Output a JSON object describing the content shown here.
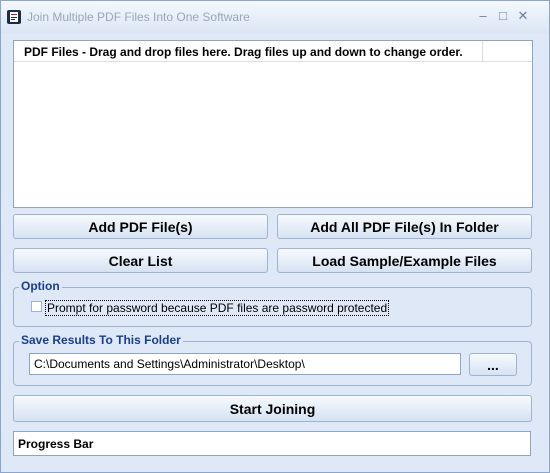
{
  "window": {
    "title": "Join Multiple PDF Files Into One Software",
    "minimize_icon": "minimize-icon",
    "maximize_icon": "maximize-icon",
    "close_icon": "close-icon"
  },
  "file_list": {
    "header": "PDF Files - Drag and drop files here. Drag files up and down to change order.",
    "items": []
  },
  "buttons": {
    "add_pdf": "Add PDF File(s)",
    "add_folder": "Add All PDF File(s) In Folder",
    "clear_list": "Clear List",
    "load_sample": "Load Sample/Example Files",
    "browse": "...",
    "start_joining": "Start Joining"
  },
  "option": {
    "group_label": "Option",
    "password_checkbox_label": "Prompt for password because PDF files are password protected",
    "password_checked": false
  },
  "save": {
    "group_label": "Save Results To This Folder",
    "path": "C:\\Documents and Settings\\Administrator\\Desktop\\"
  },
  "progress": {
    "label": "Progress Bar"
  },
  "colors": {
    "background": "#dfe8f6",
    "group_label": "#1a3f8f",
    "border": "#9fb3d1"
  }
}
